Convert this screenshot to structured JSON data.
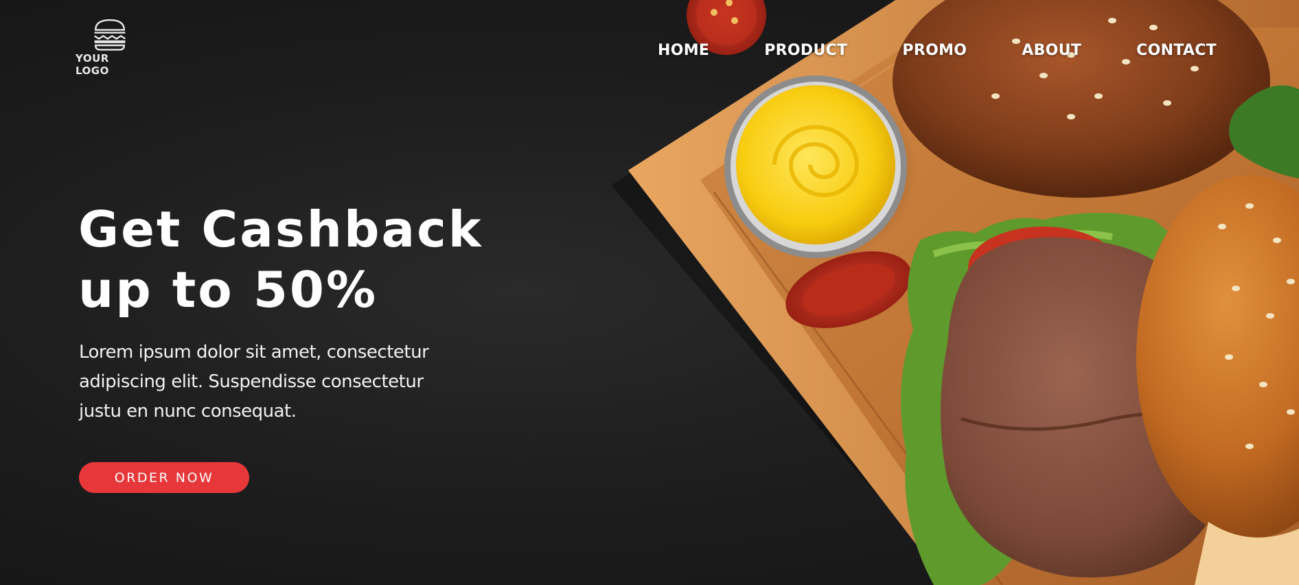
{
  "logo": {
    "text": "YOUR LOGO",
    "icon": "burger-icon"
  },
  "nav": {
    "items": [
      {
        "label": "HOME"
      },
      {
        "label": "PRODUCT"
      },
      {
        "label": "PROMO"
      },
      {
        "label": "ABOUT"
      },
      {
        "label": "CONTACT"
      }
    ]
  },
  "hero": {
    "headline_line1": "Get Cashback",
    "headline_line2": "up to 50%",
    "description": "Lorem ipsum dolor sit amet, consectetur adipiscing elit. Suspendisse consectetur justu en nunc consequat.",
    "cta_label": "ORDER NOW",
    "image": "burgers-on-wooden-board-photo"
  },
  "colors": {
    "background": "#1a1a1a",
    "accent": "#e8373a",
    "text": "#ffffff"
  }
}
